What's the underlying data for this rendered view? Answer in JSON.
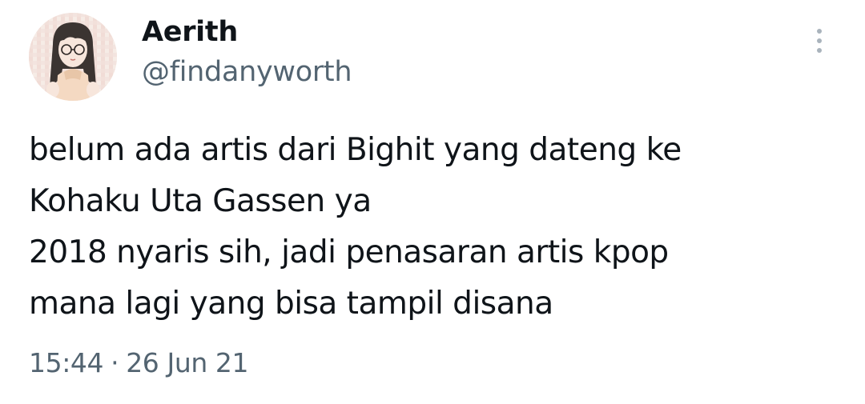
{
  "author": {
    "display_name": "Aerith",
    "handle": "@findanyworth",
    "avatar_icon": "avatar-illustration"
  },
  "menu_icon": "more-vertical-icon",
  "tweet": {
    "lines": [
      "belum ada artis dari Bighit yang dateng ke",
      "Kohaku Uta Gassen ya",
      "2018 nyaris sih, jadi penasaran artis kpop",
      "mana lagi yang bisa tampil disana"
    ]
  },
  "meta": {
    "time": "15:44",
    "separator": "·",
    "date": "26 Jun 21"
  },
  "colors": {
    "text": "#0f1419",
    "secondary": "#536471",
    "icon": "#a9b3bc"
  }
}
